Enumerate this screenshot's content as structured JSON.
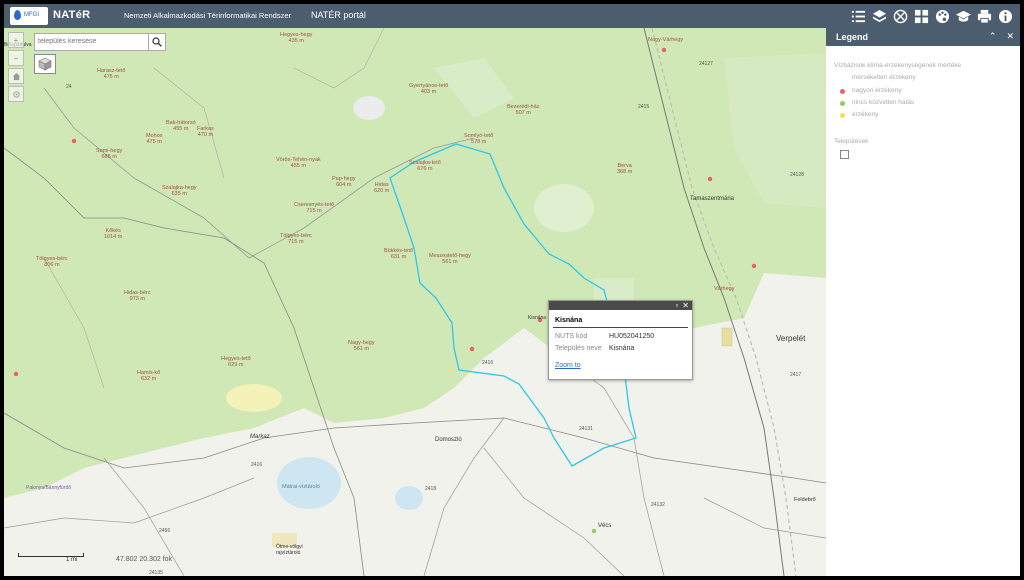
{
  "header": {
    "brand": "NATéR",
    "logo_text": "MFGI",
    "subtitle": "Nemzeti Alkalmazkodási Térinformatikai Rendszer",
    "portal_label": "NATÉR portál",
    "icons": [
      "list-icon",
      "layers-icon",
      "tools-icon",
      "grid-icon",
      "palette-icon",
      "education-icon",
      "print-icon",
      "info-icon"
    ]
  },
  "search": {
    "placeholder": "település keresése",
    "icon": "search-icon"
  },
  "map": {
    "peaks": [
      {
        "name": "Hegyes-hegy",
        "elev": "435 m"
      },
      {
        "name": "Nagy-Várhegy",
        "elev": ""
      },
      {
        "name": "Harasz-tető",
        "elev": "475 m"
      },
      {
        "name": "Gyertyános-tető",
        "elev": "403 m"
      },
      {
        "name": "Bak-hátorsó",
        "elev": "455 m"
      },
      {
        "name": "Farkas",
        "elev": "470 m"
      },
      {
        "name": "Mohos",
        "elev": "475 m"
      },
      {
        "name": "Somi-hegy",
        "elev": "688 m"
      },
      {
        "name": "Szalajka-hegy",
        "elev": "635 m"
      },
      {
        "name": "Vörös-Tehén-nyak",
        "elev": "455 m"
      },
      {
        "name": "Bezerédi-ház",
        "elev": "507 m"
      },
      {
        "name": "Somlyó-tető",
        "elev": "578 m"
      },
      {
        "name": "Berva",
        "elev": "368 m"
      },
      {
        "name": "Szalajka-tető",
        "elev": "676 m"
      },
      {
        "name": "Pap-hegy",
        "elev": "604 m"
      },
      {
        "name": "Hidas",
        "elev": "620 m"
      },
      {
        "name": "Cseresnyés-tető",
        "elev": "715 m"
      },
      {
        "name": "Kőkés",
        "elev": "1014 m"
      },
      {
        "name": "Tölgyes-bérc",
        "elev": "715 m"
      },
      {
        "name": "Tölgyes-bérc",
        "elev": "806 m"
      },
      {
        "name": "Bükkés-tető",
        "elev": "631 m"
      },
      {
        "name": "Meszestető-hegy",
        "elev": "561 m"
      },
      {
        "name": "Hidas-bérc",
        "elev": "973 m"
      },
      {
        "name": "Nagy-hegy",
        "elev": "561 m"
      },
      {
        "name": "Várhegy",
        "elev": ""
      },
      {
        "name": "Hegyes-tető",
        "elev": "629 m"
      },
      {
        "name": "Hamis-kő",
        "elev": "632 m"
      }
    ],
    "towns": [
      "Tamaszentmária",
      "Verpelét",
      "Domoszló",
      "Markaz",
      "Feldebrő",
      "Vécs",
      "Mátrai-víztároló",
      "Ötme-völgyi rajvíztároló",
      "Palonya/Bánnyfürdő",
      "Bélapátfalva",
      "Kisnána"
    ],
    "roads": [
      "24",
      "2415",
      "24127",
      "24128",
      "2416",
      "2417",
      "2418",
      "24131",
      "24132",
      "24135",
      "2456",
      "2416"
    ],
    "scale_label": "1 mi",
    "coords": "47.802  20.302 fok"
  },
  "popup": {
    "title": "Kisnána",
    "rows": [
      {
        "key": "NUTS kód",
        "value": "HU052041250"
      },
      {
        "key": "Település neve",
        "value": "Kisnána"
      }
    ],
    "zoom_label": "Zoom to"
  },
  "legend": {
    "title": "Legend",
    "layer_title": "Vízbázisok klíma-érzékenységének mértéke",
    "layer_subtitle": "mérsékelten érzékeny",
    "items": [
      {
        "label": "nagyon érzékeny",
        "color": "#f0606a"
      },
      {
        "label": "nincs közvetlen hatás",
        "color": "#8fd050"
      },
      {
        "label": "érzékeny",
        "color": "#f5e050"
      }
    ],
    "second_layer": "Települések"
  }
}
